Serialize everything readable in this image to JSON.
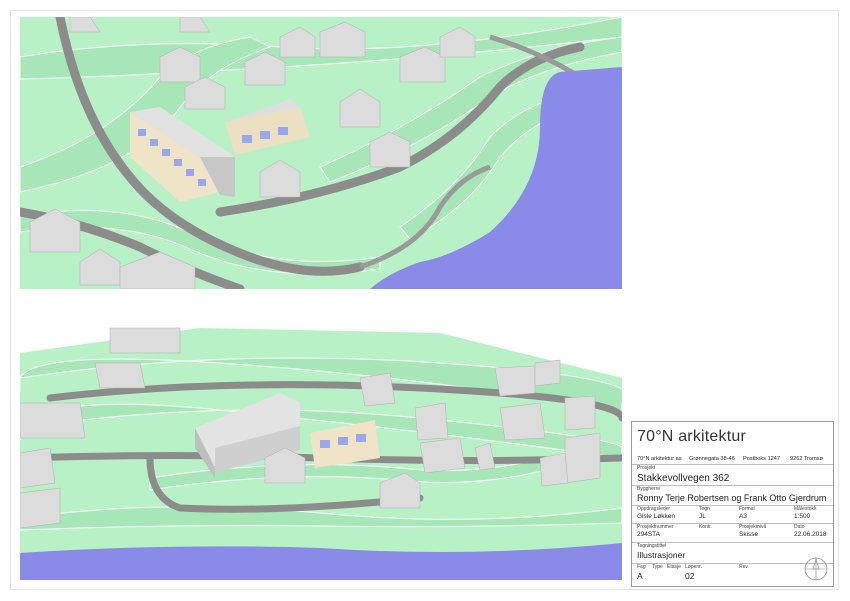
{
  "title_block": {
    "firm": "70°N arkitektur",
    "address": {
      "company": "70°N arkitektur as",
      "street": "Grønnegata 38-46",
      "postbox": "Postboks 1247",
      "city": "9262 Tromsø"
    },
    "project": {
      "label": "Prosjekt",
      "value": "Stakkevollvegen 362"
    },
    "client": {
      "label": "Byggherre",
      "value": "Ronny Terje Robertsen og Frank Otto Gjerdrum"
    },
    "fields_row1": [
      {
        "label": "Oppdragsleder",
        "value": "Gisle Løkken"
      },
      {
        "label": "Tegn",
        "value": "JL"
      },
      {
        "label": "Format",
        "value": "A3"
      },
      {
        "label": "Målestokk",
        "value": "1:500"
      }
    ],
    "fields_row2": [
      {
        "label": "Prosjektnummer",
        "value": "294STA"
      },
      {
        "label": "Kontr.",
        "value": ""
      },
      {
        "label": "Prosjektnivå",
        "value": "Skisse"
      },
      {
        "label": "Dato",
        "value": "22.06.2018"
      }
    ],
    "drawing_type": {
      "label": "Tegningstittel",
      "value": "Illustrasjoner"
    },
    "bottom_labels": {
      "fag": "Fag",
      "type": "Type",
      "etasje": "Etasje",
      "lopenr": "Løpenr.",
      "rev": "Rev."
    },
    "bottom_values": {
      "fag": "A",
      "lopenr": "02"
    }
  },
  "colors": {
    "terrain": "#b5f0c3",
    "terrain_dark": "#8fd9a1",
    "road": "#8c8c8c",
    "water": "#8a8ae8",
    "building": "#dcdcdc",
    "building_shadow": "#a9a9a9",
    "facade_warm": "#efe3c8",
    "window": "#9aa6ee"
  }
}
